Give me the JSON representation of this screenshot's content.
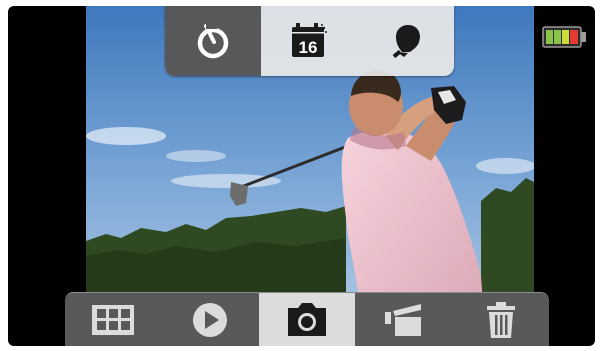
{
  "top_bar": {
    "items": [
      {
        "name": "self-timer",
        "icon": "self-timer-icon",
        "active": true
      },
      {
        "name": "date-stamp",
        "icon": "calendar-icon",
        "active": false,
        "label": "16"
      },
      {
        "name": "light",
        "icon": "bulb-icon",
        "active": false
      }
    ]
  },
  "bottom_bar": {
    "items": [
      {
        "name": "gallery",
        "icon": "grid-icon",
        "active": false
      },
      {
        "name": "playback",
        "icon": "play-icon",
        "active": false
      },
      {
        "name": "photo",
        "icon": "camera-icon",
        "active": true
      },
      {
        "name": "video",
        "icon": "video-camera-icon",
        "active": false
      },
      {
        "name": "delete",
        "icon": "trash-icon",
        "active": false
      }
    ]
  },
  "battery": {
    "icon": "battery-icon",
    "level_fraction": 0.8,
    "colors": [
      "#8bc34a",
      "#cddc39",
      "#e53935"
    ]
  },
  "colors": {
    "bar_dark": "#58595b",
    "bar_light": "#e8e8e8",
    "active_dark": "#58585a",
    "active_light": "#dcdcdc"
  }
}
